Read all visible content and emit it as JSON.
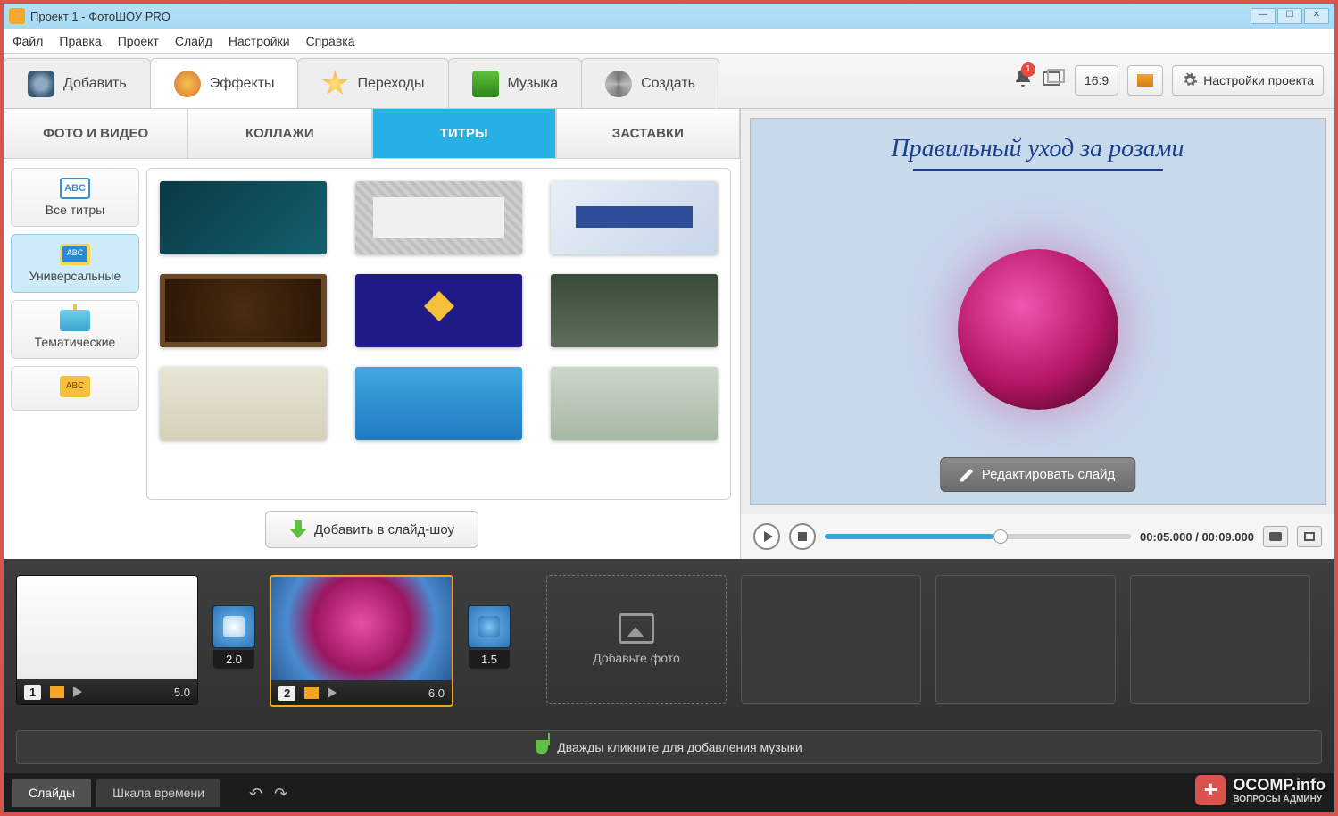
{
  "window": {
    "title": "Проект 1 - ФотоШОУ PRO"
  },
  "menu": {
    "file": "Файл",
    "edit": "Правка",
    "project": "Проект",
    "slide": "Слайд",
    "settings": "Настройки",
    "help": "Справка"
  },
  "maintabs": {
    "add": "Добавить",
    "effects": "Эффекты",
    "transitions": "Переходы",
    "music": "Музыка",
    "create": "Создать"
  },
  "right_tools": {
    "notify_count": "1",
    "aspect": "16:9",
    "settings_label": "Настройки проекта"
  },
  "subtabs": {
    "photo_video": "ФОТО И ВИДЕО",
    "collages": "КОЛЛАЖИ",
    "titles": "ТИТРЫ",
    "splash": "ЗАСТАВКИ"
  },
  "categories": {
    "all": "Все титры",
    "universal": "Универсальные",
    "thematic": "Тематические"
  },
  "add_button": "Добавить в слайд-шоу",
  "preview": {
    "title": "Правильный уход за розами",
    "edit_slide": "Редактировать слайд"
  },
  "player": {
    "current": "00:05.000",
    "sep": " / ",
    "total": "00:09.000"
  },
  "timeline": {
    "slides": [
      {
        "num": "1",
        "duration": "5.0"
      },
      {
        "num": "2",
        "duration": "6.0"
      }
    ],
    "transitions": [
      {
        "duration": "2.0"
      },
      {
        "duration": "1.5"
      }
    ],
    "add_photo": "Добавьте фото",
    "music_hint": "Дважды кликните для добавления музыки"
  },
  "bottom": {
    "slides": "Слайды",
    "timeline": "Шкала времени"
  },
  "watermark": {
    "line1": "OCOMP.info",
    "line2": "ВОПРОСЫ АДМИНУ"
  }
}
